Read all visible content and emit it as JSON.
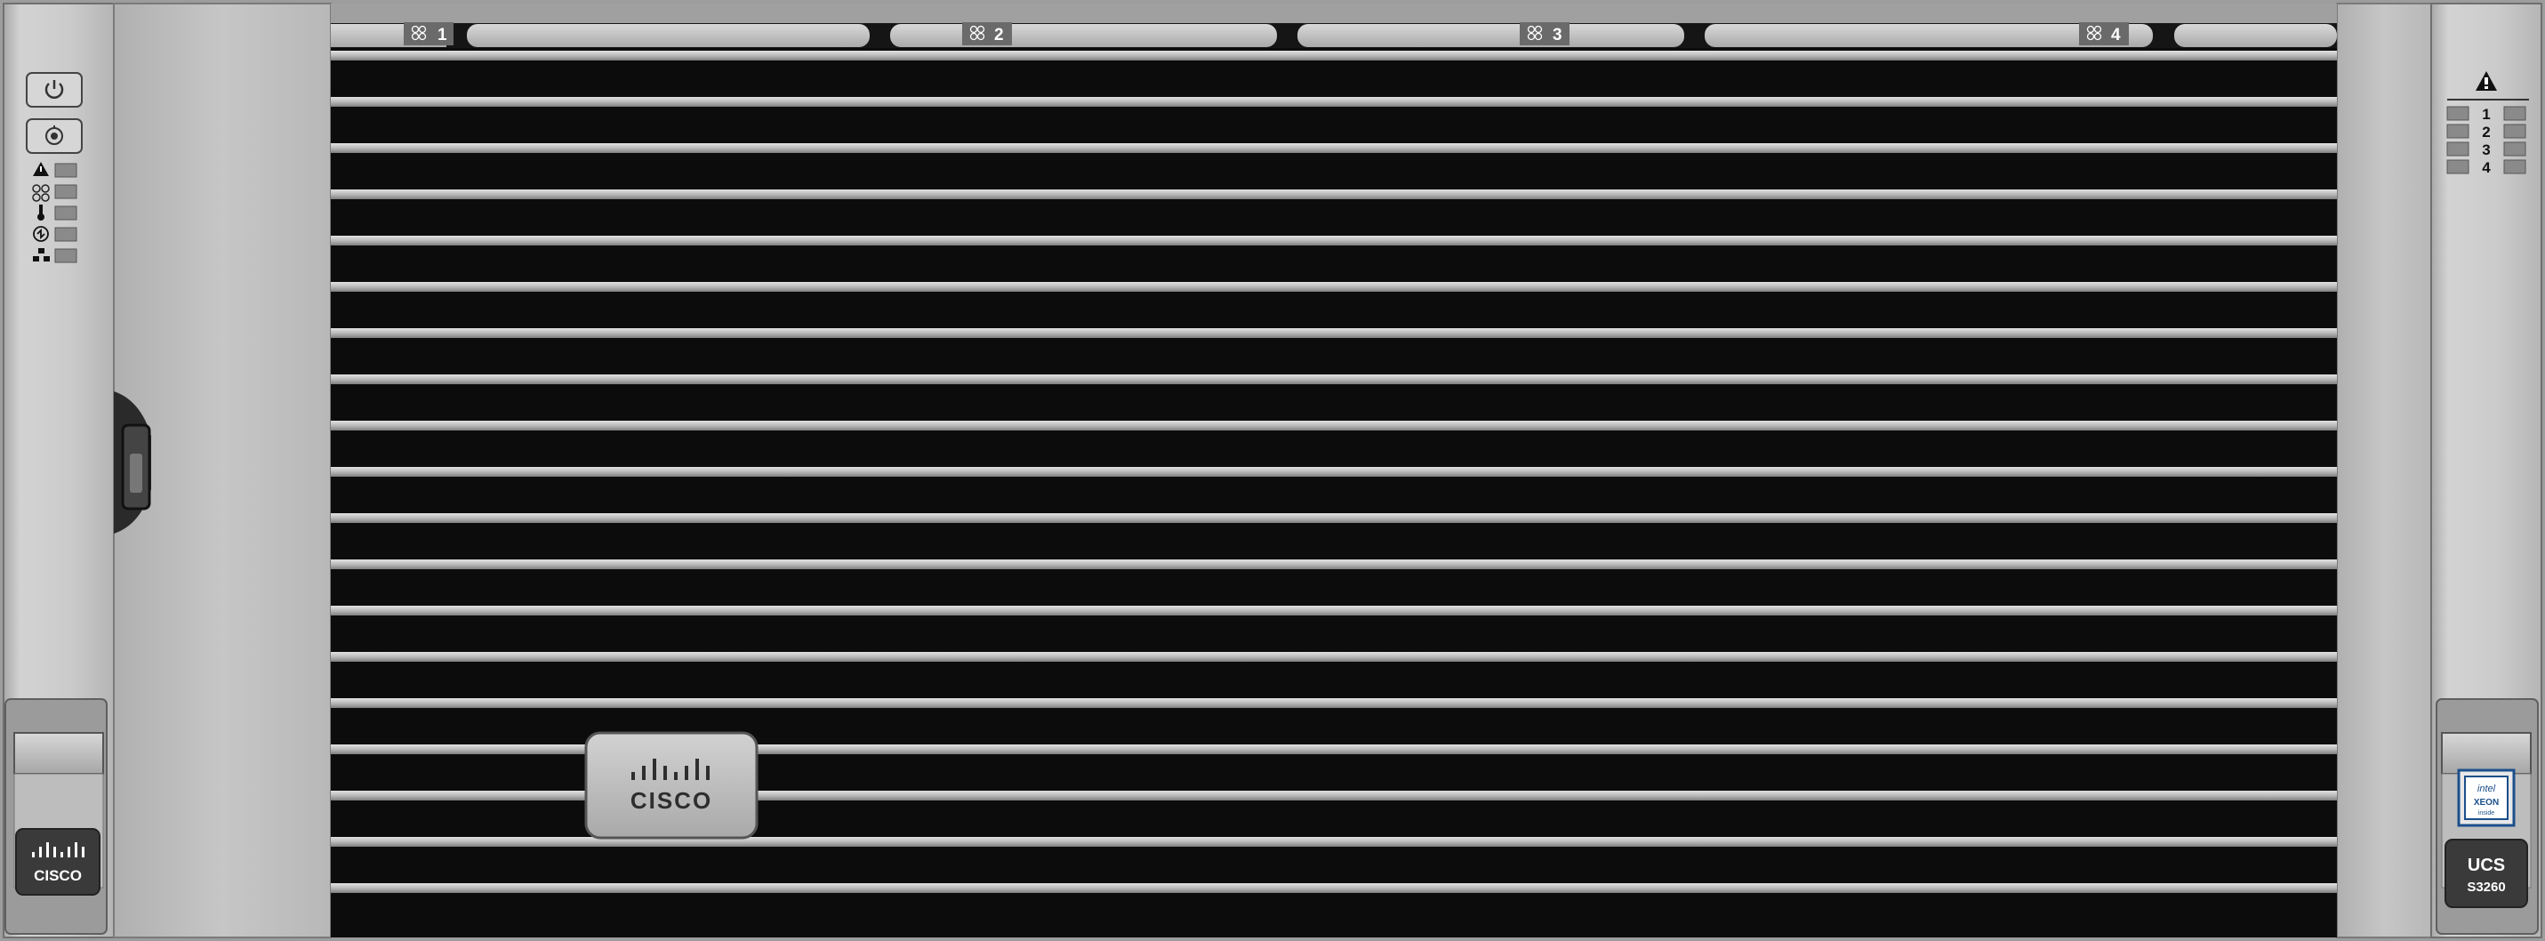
{
  "device": {
    "fan_bays": [
      "1",
      "2",
      "3",
      "4"
    ],
    "right_panel": {
      "slot_numbers": [
        "1",
        "2",
        "3",
        "4"
      ]
    },
    "bezel_logo": {
      "text": "CISCO"
    },
    "left_ear": {
      "logo_text": "CISCO"
    },
    "right_ear": {
      "model_line1": "UCS",
      "model_line2": "S3260",
      "badge_text": {
        "brand": "intel",
        "product": "XEON",
        "tier": "inside"
      }
    },
    "status_icons": [
      "power-icon",
      "locator-icon",
      "fault-icon",
      "fan-icon",
      "temperature-icon",
      "psu-icon",
      "network-icon"
    ]
  },
  "colors": {
    "ear_silver": "#c8c8c8",
    "grille_dark": "#0c0c0c",
    "slat_light": "#bdbdbd",
    "led_gray": "#8a8a8a"
  }
}
